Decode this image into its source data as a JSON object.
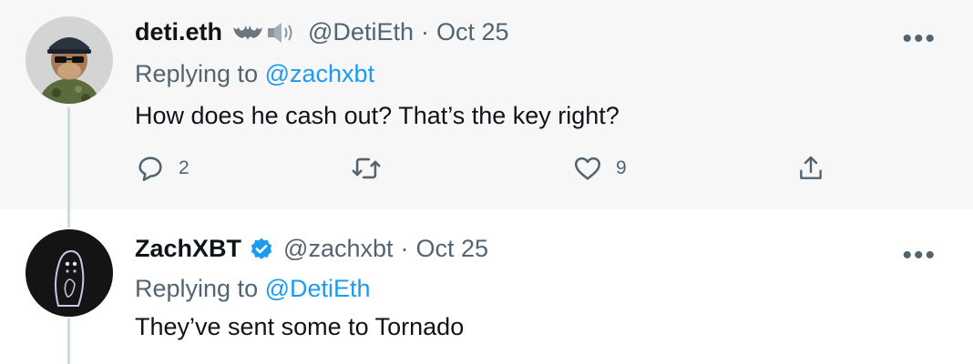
{
  "tweets": [
    {
      "display_name": "deti.eth",
      "handle": "@DetiEth",
      "separator": "·",
      "date": "Oct 25",
      "replying_prefix": "Replying to",
      "replying_to": "@zachxbt",
      "text": "How does he cash out? That’s the key right?",
      "more": "•••",
      "name_emoji": [
        "bat-icon",
        "speaker-icon"
      ],
      "actions": {
        "reply_count": "2",
        "retweet_count": "",
        "like_count": "9"
      }
    },
    {
      "display_name": "ZachXBT",
      "verified": true,
      "handle": "@zachxbt",
      "separator": "·",
      "date": "Oct 25",
      "replying_prefix": "Replying to",
      "replying_to": "@DetiEth",
      "text": "They’ve sent some to Tornado",
      "more": "•••"
    }
  ],
  "colors": {
    "accent": "#1d9bf0",
    "secondary_text": "#536471",
    "highlight_bg": "#f7f7f7",
    "thread_line": "#cfd9de"
  }
}
